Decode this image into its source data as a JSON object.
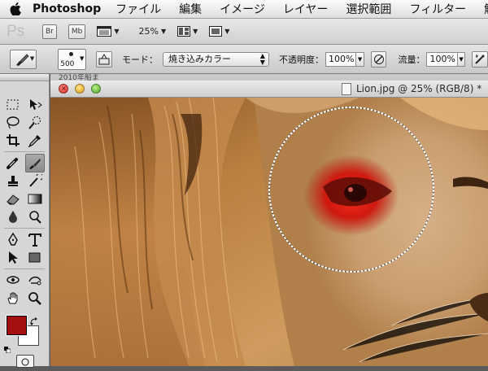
{
  "menubar": {
    "apple_icon": "apple-logo-icon",
    "app_name": "Photoshop",
    "items": [
      "ファイル",
      "編集",
      "イメージ",
      "レイヤー",
      "選択範囲",
      "フィルター",
      "解析"
    ]
  },
  "appbar": {
    "logo": "Ps",
    "bridge_label": "Br",
    "minibridge_label": "Mb",
    "zoom_value": "25%"
  },
  "options": {
    "brush_size": "500",
    "mode_label": "モード：",
    "mode_value": "焼き込みカラー",
    "opacity_label": "不透明度：",
    "opacity_value": "100%",
    "flow_label": "流量：",
    "flow_value": "100%"
  },
  "colors": {
    "foreground": "#a40f10",
    "background": "#ffffff"
  },
  "document": {
    "title": "Lion.jpg @ 25% (RGB/8) *",
    "behind_text": "2010年船ま"
  }
}
